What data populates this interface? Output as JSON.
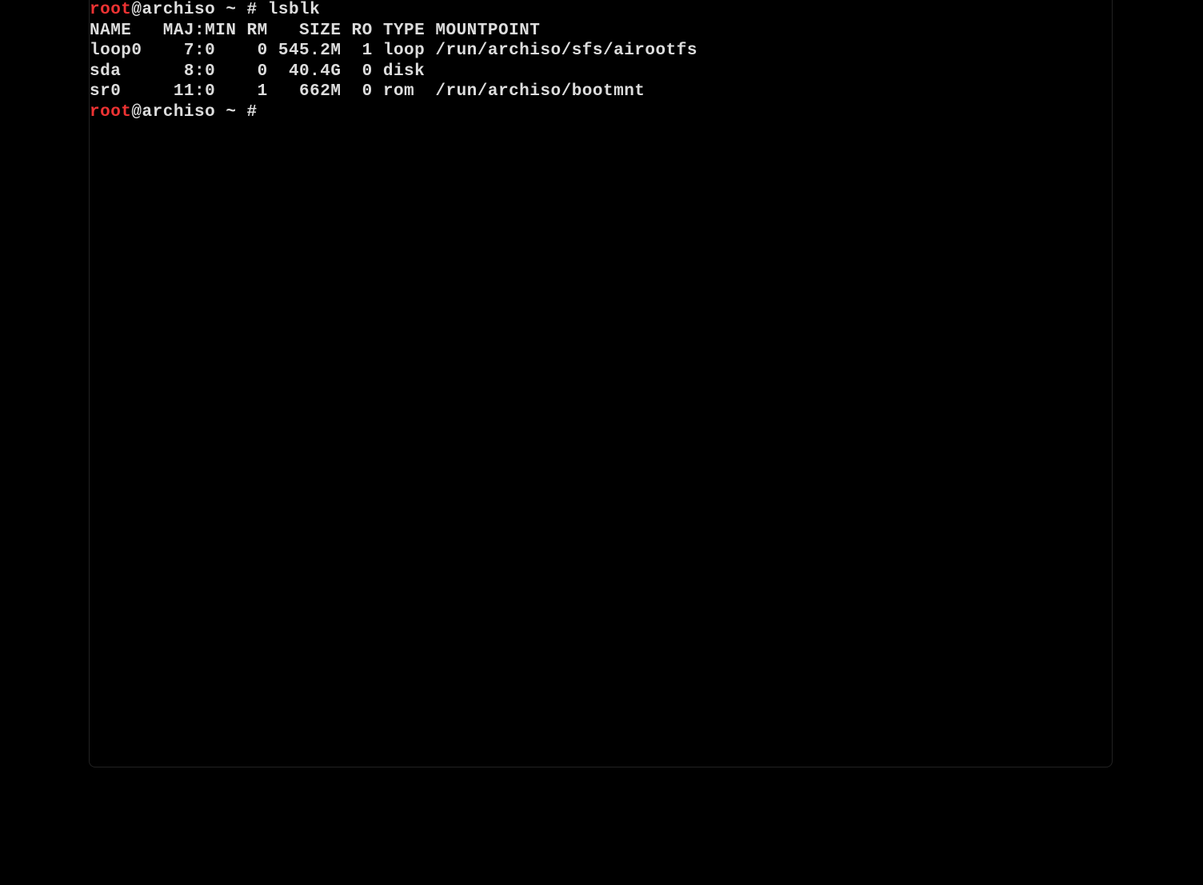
{
  "prompt": {
    "user": "root",
    "host_part": "@archiso ~ # "
  },
  "command1": "lsblk",
  "output": {
    "header": "NAME   MAJ:MIN RM   SIZE RO TYPE MOUNTPOINT",
    "rows": [
      "loop0    7:0    0 545.2M  1 loop /run/archiso/sfs/airootfs",
      "sda      8:0    0  40.4G  0 disk ",
      "sr0     11:0    1   662M  0 rom  /run/archiso/bootmnt"
    ]
  },
  "prompt2": {
    "user": "root",
    "host_part": "@archiso ~ # "
  }
}
